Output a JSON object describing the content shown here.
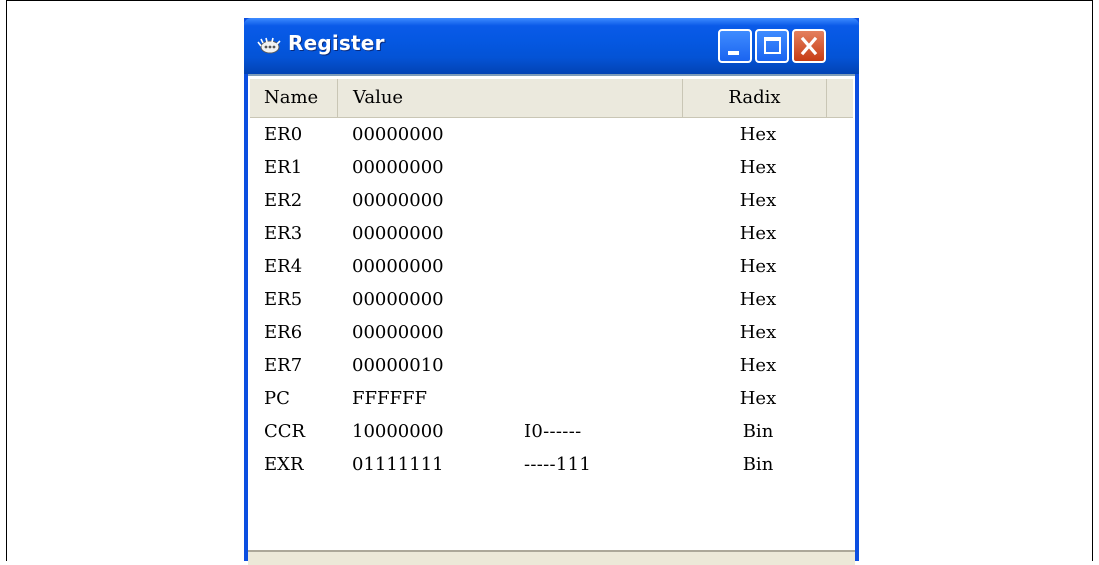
{
  "window": {
    "title": "Register"
  },
  "table": {
    "columns": {
      "name": "Name",
      "value": "Value",
      "radix": "Radix"
    },
    "rows": [
      {
        "name": "ER0",
        "value": "00000000",
        "extra": "",
        "radix": "Hex"
      },
      {
        "name": "ER1",
        "value": "00000000",
        "extra": "",
        "radix": "Hex"
      },
      {
        "name": "ER2",
        "value": "00000000",
        "extra": "",
        "radix": "Hex"
      },
      {
        "name": "ER3",
        "value": "00000000",
        "extra": "",
        "radix": "Hex"
      },
      {
        "name": "ER4",
        "value": "00000000",
        "extra": "",
        "radix": "Hex"
      },
      {
        "name": "ER5",
        "value": "00000000",
        "extra": "",
        "radix": "Hex"
      },
      {
        "name": "ER6",
        "value": "00000000",
        "extra": "",
        "radix": "Hex"
      },
      {
        "name": "ER7",
        "value": "00000010",
        "extra": "",
        "radix": "Hex"
      },
      {
        "name": "PC",
        "value": "FFFFFF",
        "extra": "",
        "radix": "Hex"
      },
      {
        "name": "CCR",
        "value": "10000000",
        "extra": "I0------",
        "radix": "Bin"
      },
      {
        "name": "EXR",
        "value": "01111111",
        "extra": "-----111",
        "radix": "Bin"
      }
    ]
  },
  "icons": {
    "app": "register-app-icon",
    "minimize": "minimize-icon",
    "maximize": "maximize-icon",
    "close": "close-icon"
  },
  "colors": {
    "titlebar": "#0558e2",
    "close_button": "#c73c14",
    "header_bg": "#ebe9dd"
  }
}
